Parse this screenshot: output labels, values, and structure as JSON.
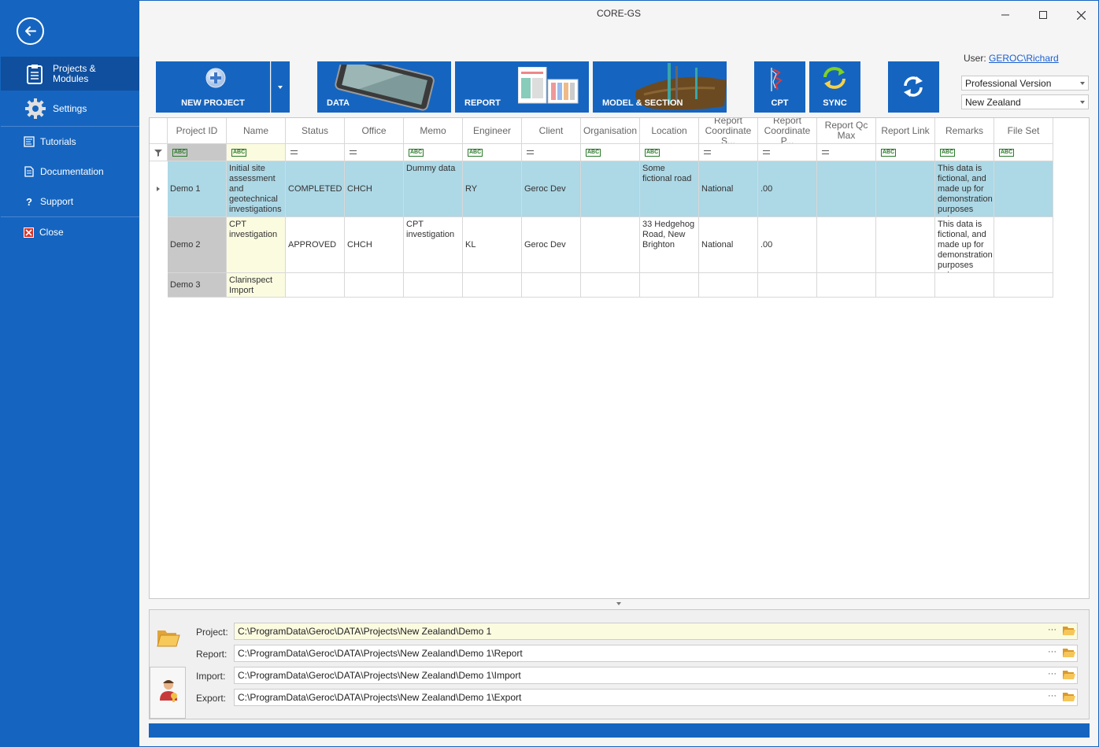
{
  "app": {
    "title": "CORE-GS"
  },
  "sidebar": {
    "items": [
      {
        "label": "Projects &\nModules"
      },
      {
        "label": "Settings"
      },
      {
        "label": "Tutorials"
      },
      {
        "label": "Documentation"
      },
      {
        "label": "Support"
      },
      {
        "label": "Close"
      }
    ]
  },
  "toolbar": {
    "new_project": "NEW PROJECT",
    "data": "DATA",
    "report": "REPORT",
    "model_section": "MODEL & SECTION",
    "cpt": "CPT",
    "sync": "SYNC"
  },
  "user": {
    "label": "User:",
    "name": "GEROC\\Richard"
  },
  "version_combo": {
    "value": "Professional Version"
  },
  "region_combo": {
    "value": "New Zealand"
  },
  "grid": {
    "columns": [
      "Project ID",
      "Name",
      "Status",
      "Office",
      "Memo",
      "Engineer",
      "Client",
      "Organisation",
      "Location",
      "Report\nCoordinate S...",
      "Report\nCoordinate P...",
      "Report Qc\nMax",
      "Report Link",
      "Remarks",
      "File Set"
    ],
    "rows": [
      [
        "Demo 1",
        "Initial site assessment and geotechnical investigations",
        "COMPLETED",
        "CHCH",
        "Dummy data",
        "RY",
        "Geroc Dev",
        "",
        "Some fictional road",
        "National",
        ".00",
        "",
        "",
        "This data is fictional, and made up for demonstration purposes only",
        ""
      ],
      [
        "Demo 2",
        "CPT investigation",
        "APPROVED",
        "CHCH",
        "CPT investigation",
        "KL",
        "Geroc Dev",
        "",
        "33 Hedgehog Road, New Brighton",
        "National",
        ".00",
        "",
        "",
        "This data is fictional, and made up for demonstration purposes only",
        ""
      ],
      [
        "Demo 3",
        "Clarinspect Import",
        "",
        "",
        "",
        "",
        "",
        "",
        "",
        "",
        "",
        "",
        "",
        "",
        ""
      ]
    ]
  },
  "paths": {
    "project": {
      "label": "Project:",
      "value": "C:\\ProgramData\\Geroc\\DATA\\Projects\\New Zealand\\Demo 1"
    },
    "report": {
      "label": "Report:",
      "value": "C:\\ProgramData\\Geroc\\DATA\\Projects\\New Zealand\\Demo 1\\Report"
    },
    "import": {
      "label": "Import:",
      "value": "C:\\ProgramData\\Geroc\\DATA\\Projects\\New Zealand\\Demo 1\\Import"
    },
    "export": {
      "label": "Export:",
      "value": "C:\\ProgramData\\Geroc\\DATA\\Projects\\New Zealand\\Demo 1\\Export"
    },
    "browse_dots": "···"
  },
  "colors": {
    "accent": "#1565c0",
    "selected_row": "#add8e6",
    "id_col": "#c8c8c8",
    "name_col": "#fbfbe0"
  }
}
